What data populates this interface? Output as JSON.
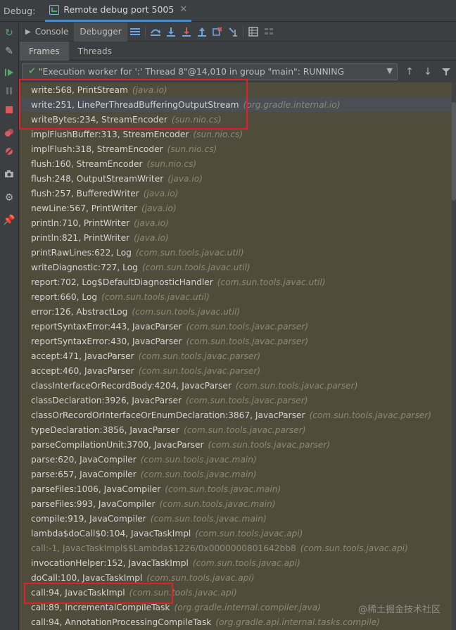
{
  "title_bar": {
    "label": "Debug:",
    "session_tab": "Remote debug port 5005",
    "close_glyph": "✕"
  },
  "toolbar": {
    "console_label": "Console",
    "debugger_label": "Debugger"
  },
  "subtabs": {
    "frames_label": "Frames",
    "threads_label": "Threads"
  },
  "thread_selector": {
    "value": "\"Execution worker for ':' Thread 8\"@14,010 in group \"main\": RUNNING"
  },
  "frames": [
    {
      "loc": "write:568, PrintStream",
      "pkg": "(java.io)"
    },
    {
      "loc": "write:251, LinePerThreadBufferingOutputStream",
      "pkg": "(org.gradle.internal.io)",
      "selected": true
    },
    {
      "loc": "writeBytes:234, StreamEncoder",
      "pkg": "(sun.nio.cs)"
    },
    {
      "loc": "implFlushBuffer:313, StreamEncoder",
      "pkg": "(sun.nio.cs)"
    },
    {
      "loc": "implFlush:318, StreamEncoder",
      "pkg": "(sun.nio.cs)"
    },
    {
      "loc": "flush:160, StreamEncoder",
      "pkg": "(sun.nio.cs)"
    },
    {
      "loc": "flush:248, OutputStreamWriter",
      "pkg": "(java.io)"
    },
    {
      "loc": "flush:257, BufferedWriter",
      "pkg": "(java.io)"
    },
    {
      "loc": "newLine:567, PrintWriter",
      "pkg": "(java.io)"
    },
    {
      "loc": "println:710, PrintWriter",
      "pkg": "(java.io)"
    },
    {
      "loc": "println:821, PrintWriter",
      "pkg": "(java.io)"
    },
    {
      "loc": "printRawLines:622, Log",
      "pkg": "(com.sun.tools.javac.util)"
    },
    {
      "loc": "writeDiagnostic:727, Log",
      "pkg": "(com.sun.tools.javac.util)"
    },
    {
      "loc": "report:702, Log$DefaultDiagnosticHandler",
      "pkg": "(com.sun.tools.javac.util)"
    },
    {
      "loc": "report:660, Log",
      "pkg": "(com.sun.tools.javac.util)"
    },
    {
      "loc": "error:126, AbstractLog",
      "pkg": "(com.sun.tools.javac.util)"
    },
    {
      "loc": "reportSyntaxError:443, JavacParser",
      "pkg": "(com.sun.tools.javac.parser)"
    },
    {
      "loc": "reportSyntaxError:430, JavacParser",
      "pkg": "(com.sun.tools.javac.parser)"
    },
    {
      "loc": "accept:471, JavacParser",
      "pkg": "(com.sun.tools.javac.parser)"
    },
    {
      "loc": "accept:460, JavacParser",
      "pkg": "(com.sun.tools.javac.parser)"
    },
    {
      "loc": "classInterfaceOrRecordBody:4204, JavacParser",
      "pkg": "(com.sun.tools.javac.parser)"
    },
    {
      "loc": "classDeclaration:3926, JavacParser",
      "pkg": "(com.sun.tools.javac.parser)"
    },
    {
      "loc": "classOrRecordOrInterfaceOrEnumDeclaration:3867, JavacParser",
      "pkg": "(com.sun.tools.javac.parser)"
    },
    {
      "loc": "typeDeclaration:3856, JavacParser",
      "pkg": "(com.sun.tools.javac.parser)"
    },
    {
      "loc": "parseCompilationUnit:3700, JavacParser",
      "pkg": "(com.sun.tools.javac.parser)"
    },
    {
      "loc": "parse:620, JavaCompiler",
      "pkg": "(com.sun.tools.javac.main)"
    },
    {
      "loc": "parse:657, JavaCompiler",
      "pkg": "(com.sun.tools.javac.main)"
    },
    {
      "loc": "parseFiles:1006, JavaCompiler",
      "pkg": "(com.sun.tools.javac.main)"
    },
    {
      "loc": "parseFiles:993, JavaCompiler",
      "pkg": "(com.sun.tools.javac.main)"
    },
    {
      "loc": "compile:919, JavaCompiler",
      "pkg": "(com.sun.tools.javac.main)"
    },
    {
      "loc": "lambda$doCall$0:104, JavacTaskImpl",
      "pkg": "(com.sun.tools.javac.api)"
    },
    {
      "loc": "call:-1, JavacTaskImpl$$Lambda$1226/0x0000000801642bb8",
      "pkg": "(com.sun.tools.javac.api)",
      "dim": true
    },
    {
      "loc": "invocationHelper:152, JavacTaskImpl",
      "pkg": "(com.sun.tools.javac.api)"
    },
    {
      "loc": "doCall:100, JavacTaskImpl",
      "pkg": "(com.sun.tools.javac.api)"
    },
    {
      "loc": "call:94, JavacTaskImpl",
      "pkg": "(com.sun.tools.javac.api)"
    },
    {
      "loc": "call:89, IncrementalCompileTask",
      "pkg": "(org.gradle.internal.compiler.java)"
    },
    {
      "loc": "call:94, AnnotationProcessingCompileTask",
      "pkg": "(org.gradle.api.internal.tasks.compile)"
    }
  ],
  "watermark": "@稀土掘金技术社区",
  "colors": {
    "accent": "#4a88c7",
    "highlight_box": "#e0212a",
    "frames_bg": "#504c3b",
    "run_green": "#59a869",
    "stop_red": "#db5860"
  }
}
